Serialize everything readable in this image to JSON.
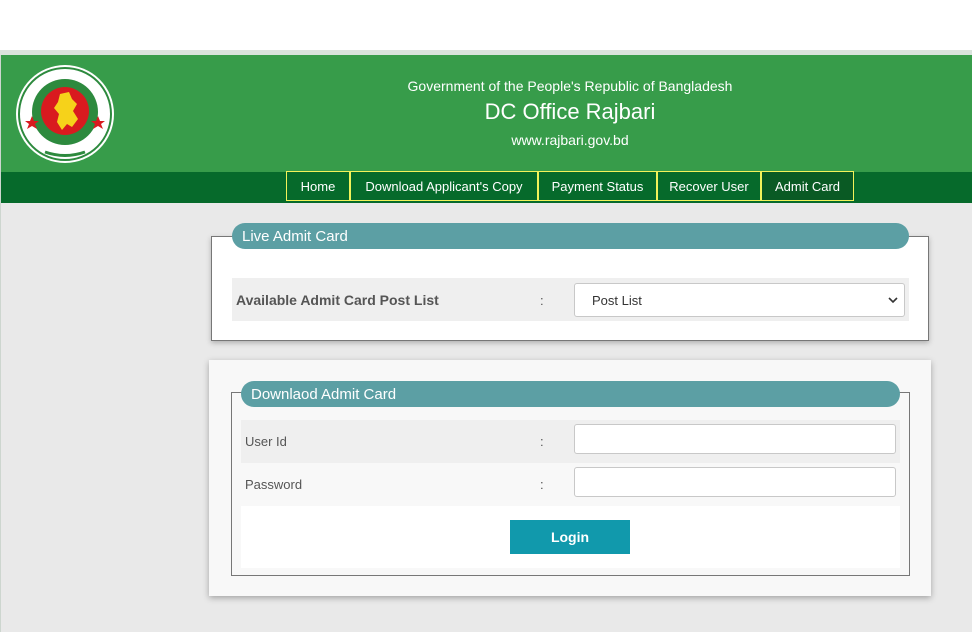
{
  "header": {
    "government": "Government of the People's Republic of Bangladesh",
    "title": "DC Office Rajbari",
    "url": "www.rajbari.gov.bd",
    "logo_icon": "bangladesh-government-seal",
    "colors": {
      "header_green": "#379c4a",
      "nav_green": "#066a2b",
      "nav_border": "#f2f25a"
    }
  },
  "nav": {
    "items": [
      {
        "label": "Home"
      },
      {
        "label": "Download Applicant's Copy"
      },
      {
        "label": "Payment Status"
      },
      {
        "label": "Recover User"
      },
      {
        "label": "Admit Card",
        "active": true
      }
    ]
  },
  "live_admit": {
    "legend": "Live Admit Card",
    "label": "Available Admit Card Post List",
    "colon": ":",
    "select_value": "Post List"
  },
  "download": {
    "legend": "Downlaod Admit Card",
    "user_label": "User Id",
    "password_label": "Password",
    "colon": ":",
    "user_value": "",
    "password_value": "",
    "login_label": "Login",
    "accent": "#1199ac"
  }
}
